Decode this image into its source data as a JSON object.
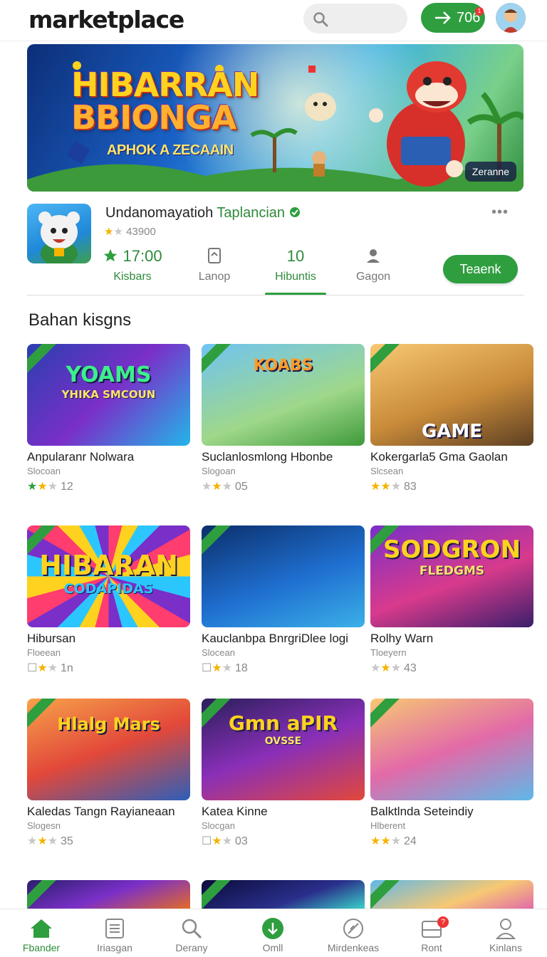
{
  "header": {
    "logo": "marketplace",
    "coins": "706",
    "notif_count": "1"
  },
  "banner": {
    "title_line1": "HIBARRAN",
    "title_line2": "BBIONGA",
    "subtitle": "APHOK A ZECAAIN",
    "button": "Zeranne"
  },
  "app": {
    "name": "Undanomayatioh",
    "name_highlight": "Taplancian",
    "rating_value": "43900",
    "more": "•••",
    "stats": [
      {
        "value": "17:00",
        "label": "Kisbars"
      },
      {
        "value": "",
        "label": "Lanop"
      },
      {
        "value": "10",
        "label": "Hibuntis"
      },
      {
        "value": "",
        "label": "Gagon"
      }
    ],
    "primary_button": "Teaenk"
  },
  "section": {
    "title": "Bahan kisgns"
  },
  "games": [
    {
      "title": "Anpularanr Nolwara",
      "sub": "Slocoan",
      "rating": "12",
      "thumb_text": "YOAMS",
      "thumb_sub": "YHIKA SMCOUN"
    },
    {
      "title": "Suclanlosmlong Hbonbe",
      "sub": "Slogoan",
      "rating": "05",
      "thumb_text": "KOABS",
      "thumb_sub": ""
    },
    {
      "title": "Kokergarla5 Gma Gaolan",
      "sub": "Slcsean",
      "rating": "83",
      "thumb_text": "GAME",
      "thumb_sub": ""
    },
    {
      "title": "Hibursan",
      "sub": "Floeean",
      "rating": "1n",
      "thumb_text": "HIBARAN",
      "thumb_sub": "CODAPIDAS"
    },
    {
      "title": "Kauclanbpa BnrgriDlee logi",
      "sub": "Slocean",
      "rating": "18",
      "thumb_text": "",
      "thumb_sub": ""
    },
    {
      "title": "Rolhy Warn",
      "sub": "Tloeyern",
      "rating": "43",
      "thumb_text": "SODGRON",
      "thumb_sub": "FLEDGMS"
    },
    {
      "title": "Kaledas Tangn Rayianeaan",
      "sub": "Slogesn",
      "rating": "35",
      "thumb_text": "Hlalg Mars",
      "thumb_sub": ""
    },
    {
      "title": "Katea Kinne",
      "sub": "Slocgan",
      "rating": "03",
      "thumb_text": "Gmn aPIR",
      "thumb_sub": "OVSSE"
    },
    {
      "title": "Balktlnda Seteindiy",
      "sub": "Hlberent",
      "rating": "24",
      "thumb_text": "",
      "thumb_sub": ""
    }
  ],
  "nav": [
    {
      "label": "Fbander"
    },
    {
      "label": "Iriasgan"
    },
    {
      "label": "Derany"
    },
    {
      "label": "Omll"
    },
    {
      "label": "Mirdenkeas"
    },
    {
      "label": "Ront"
    },
    {
      "label": "Kinlans"
    }
  ],
  "nav_badge": "?",
  "colors": {
    "accent": "#2e9e3f",
    "star": "#f4b400"
  }
}
